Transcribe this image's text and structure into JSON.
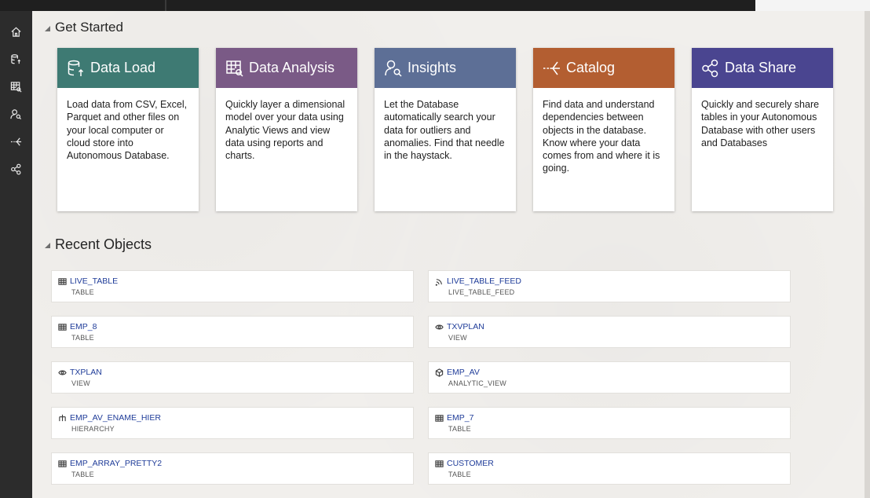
{
  "colors": {
    "data_load": "#3e7a73",
    "data_analysis": "#7a5a86",
    "insights": "#5d6f96",
    "catalog": "#b35e31",
    "data_share": "#4a4590",
    "link": "#1f3c99"
  },
  "sidebar": {
    "items": [
      {
        "icon": "home-icon"
      },
      {
        "icon": "data-load-icon"
      },
      {
        "icon": "data-analysis-icon"
      },
      {
        "icon": "insights-icon"
      },
      {
        "icon": "catalog-icon"
      },
      {
        "icon": "data-share-icon"
      }
    ]
  },
  "get_started": {
    "title": "Get Started",
    "cards": [
      {
        "icon": "data-load-icon",
        "title": "Data Load",
        "description": "Load data from CSV, Excel, Parquet and other files on your local computer or cloud store into Autonomous Database."
      },
      {
        "icon": "data-analysis-icon",
        "title": "Data Analysis",
        "description": "Quickly layer a dimensional model over your data using Analytic Views and view data using reports and charts."
      },
      {
        "icon": "insights-icon",
        "title": "Insights",
        "description": "Let the Database automatically search your data for outliers and anomalies. Find that needle in the haystack."
      },
      {
        "icon": "catalog-icon",
        "title": "Catalog",
        "description": "Find data and understand dependencies between objects in the database. Know where your data comes from and where it is going."
      },
      {
        "icon": "data-share-icon",
        "title": "Data Share",
        "description": "Quickly and securely share tables in your Autonomous Database with other users and Databases"
      }
    ]
  },
  "recent_objects": {
    "title": "Recent Objects",
    "items": [
      {
        "name": "LIVE_TABLE",
        "type": "TABLE",
        "icon": "table-icon"
      },
      {
        "name": "LIVE_TABLE_FEED",
        "type": "LIVE_TABLE_FEED",
        "icon": "feed-icon"
      },
      {
        "name": "EMP_8",
        "type": "TABLE",
        "icon": "table-icon"
      },
      {
        "name": "TXVPLAN",
        "type": "VIEW",
        "icon": "eye-icon"
      },
      {
        "name": "TXPLAN",
        "type": "VIEW",
        "icon": "eye-icon"
      },
      {
        "name": "EMP_AV",
        "type": "ANALYTIC_VIEW",
        "icon": "cube-icon"
      },
      {
        "name": "EMP_AV_ENAME_HIER",
        "type": "HIERARCHY",
        "icon": "hierarchy-icon"
      },
      {
        "name": "EMP_7",
        "type": "TABLE",
        "icon": "table-icon"
      },
      {
        "name": "EMP_ARRAY_PRETTY2",
        "type": "TABLE",
        "icon": "table-icon"
      },
      {
        "name": "CUSTOMER",
        "type": "TABLE",
        "icon": "table-icon"
      }
    ]
  }
}
